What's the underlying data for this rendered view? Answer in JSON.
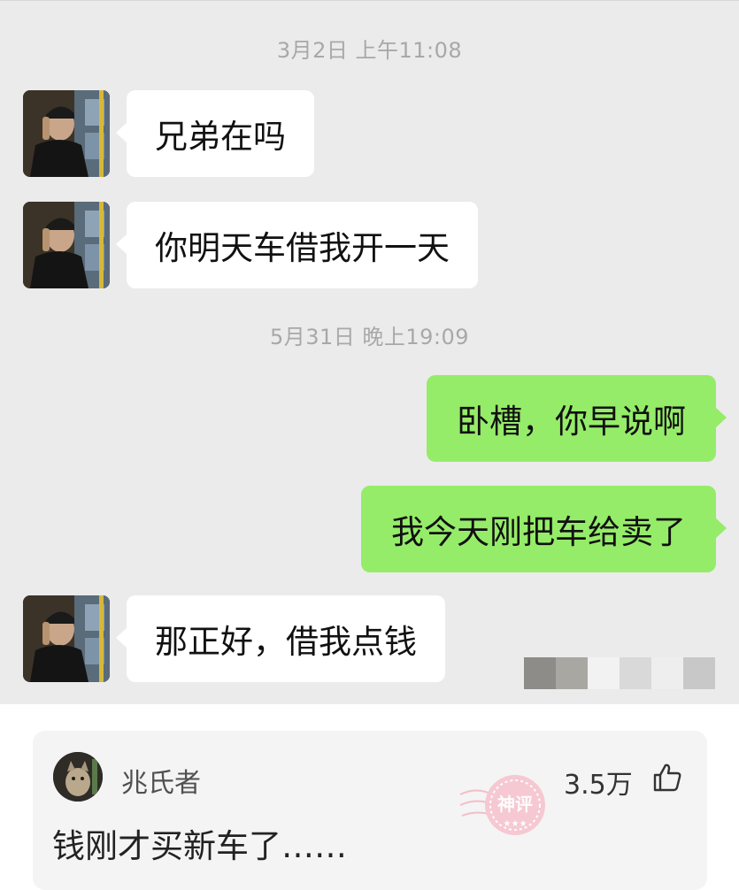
{
  "chat": {
    "timestamps": [
      "3月2日 上午11:08",
      "5月31日 晚上19:09"
    ],
    "messages": [
      {
        "side": "left",
        "text": "兄弟在吗"
      },
      {
        "side": "left",
        "text": "你明天车借我开一天"
      },
      {
        "side": "right",
        "text": "卧槽，你早说啊"
      },
      {
        "side": "right",
        "text": "我今天刚把车给卖了"
      },
      {
        "side": "left",
        "text": "那正好，借我点钱"
      }
    ],
    "colors": {
      "background": "#ebebeb",
      "incoming_bubble": "#ffffff",
      "outgoing_bubble": "#95ec69"
    },
    "avatar_icon": "friend-avatar"
  },
  "comment": {
    "author": "兆氏者",
    "likes": "3.5万",
    "like_icon": "thumbs-up-icon",
    "text": "钱刚才买新车了……",
    "avatar_icon": "cat-avatar",
    "watermark_text": "神评"
  }
}
